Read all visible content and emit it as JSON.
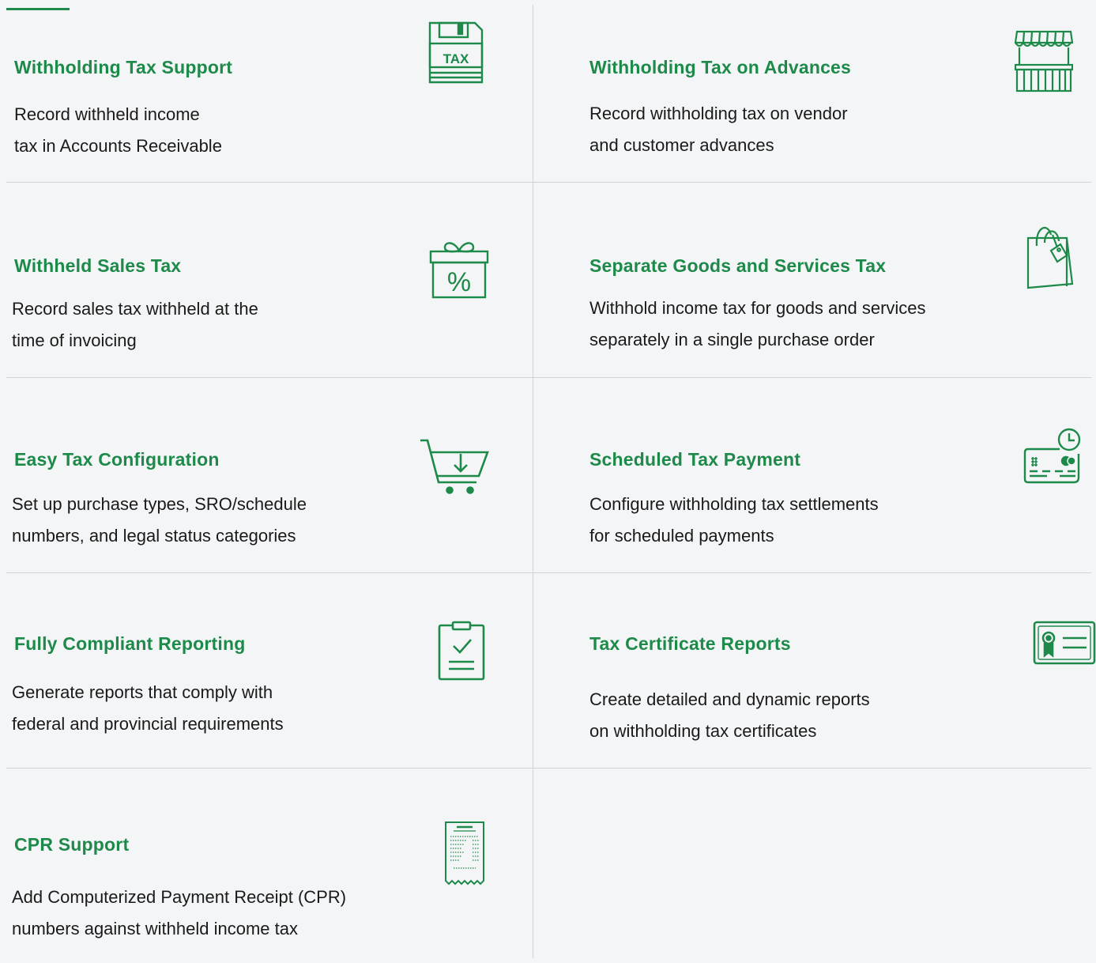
{
  "theme": {
    "accent": "#1e8a4a",
    "divider": "#cfd3d8",
    "background": "#f4f5f7"
  },
  "features": [
    {
      "title": "Withholding Tax Support",
      "desc_lines": [
        "Record withheld income",
        "tax in Accounts Receivable"
      ],
      "icon": "tax-floppy-icon",
      "icon_text": "TAX"
    },
    {
      "title": "Withholding Tax on Advances",
      "desc_lines": [
        "Record withholding tax on vendor",
        "and customer advances"
      ],
      "icon": "storefront-icon"
    },
    {
      "title": "Withheld Sales Tax",
      "desc_lines": [
        "Record sales tax withheld at the",
        "time of invoicing"
      ],
      "icon": "gift-percent-icon",
      "icon_text": "%"
    },
    {
      "title": "Separate Goods and Services Tax",
      "desc_lines": [
        "Withhold income tax for goods and services",
        "separately in a single purchase order"
      ],
      "icon": "shopping-bag-icon"
    },
    {
      "title": "Easy Tax Configuration",
      "desc_lines": [
        "Set up purchase types, SRO/schedule",
        "numbers, and legal status categories"
      ],
      "icon": "cart-icon"
    },
    {
      "title": "Scheduled Tax Payment",
      "desc_lines": [
        "Configure withholding tax settlements",
        "for scheduled payments"
      ],
      "icon": "card-clock-icon"
    },
    {
      "title": "Fully Compliant Reporting",
      "desc_lines": [
        "Generate reports that comply with",
        "federal and provincial requirements"
      ],
      "icon": "clipboard-check-icon"
    },
    {
      "title": "Tax Certificate Reports",
      "desc_lines": [
        "Create detailed and dynamic reports",
        "on withholding tax certificates"
      ],
      "icon": "certificate-icon"
    },
    {
      "title": "CPR Support",
      "desc_lines": [
        "Add Computerized Payment Receipt (CPR)",
        "numbers against withheld income tax"
      ],
      "icon": "receipt-icon"
    }
  ]
}
